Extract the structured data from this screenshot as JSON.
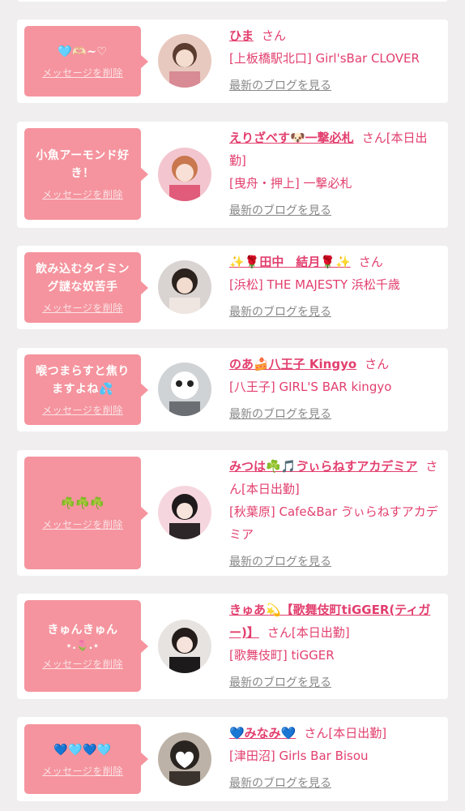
{
  "cards": [
    {
      "message": "🩵🫶🏻~♡",
      "delete_label": "メッセージを削除",
      "name": "ひま",
      "san": "さん",
      "status": "",
      "shop": "[上板橋駅北口] Girl'sBar CLOVER",
      "blog_link": "最新のブログを見る"
    },
    {
      "message": "小魚アーモンド好き！",
      "delete_label": "メッセージを削除",
      "name": "えりざべす🐶一撃必札",
      "san": "さん",
      "status": "[本日出勤]",
      "shop": "[曳舟・押上] 一撃必札",
      "blog_link": "最新のブログを見る"
    },
    {
      "message": "飲み込むタイミング謎な奴苦手",
      "delete_label": "メッセージを削除",
      "name": "✨🌹田中　結月🌹✨",
      "san": "さん",
      "status": "",
      "shop": "[浜松] THE MAJESTY 浜松千歳",
      "blog_link": "最新のブログを見る"
    },
    {
      "message": "喉つまらすと焦りますよね💦",
      "delete_label": "メッセージを削除",
      "name": "のあ🍰八王子 Kingyo",
      "san": "さん",
      "status": "",
      "shop": "[八王子] GIRL'S BAR kingyo",
      "blog_link": "最新のブログを見る"
    },
    {
      "message": "☘️☘️☘️",
      "delete_label": "メッセージを削除",
      "name": "みつは☘️🎵ゔぃらねすアカデミア",
      "san": "さん",
      "status": "[本日出勤]",
      "shop": "[秋葉原] Cafe&Bar ゔぃらねすアカデミア",
      "blog_link": "最新のブログを見る"
    },
    {
      "message": "きゅんきゅん",
      "message2": "⋆.🌷.⋆",
      "delete_label": "メッセージを削除",
      "name": "きゅあ💫【歌舞伎町tiGGER(ティガー)】",
      "san": "さん",
      "status": "[本日出勤]",
      "shop": "[歌舞伎町] tiGGER",
      "blog_link": "最新のブログを見る"
    },
    {
      "message": "💙🩵💙🩵",
      "delete_label": "メッセージを削除",
      "name": "💙みなみ💙",
      "san": "さん",
      "status": "[本日出勤]",
      "shop": "[津田沼] Girls Bar Bisou",
      "blog_link": "最新のブログを見る"
    }
  ],
  "colors": {
    "background": "#f0eeee",
    "bubble": "#f5949e",
    "accent_text": "#e23f6e",
    "muted_text": "#888888"
  }
}
